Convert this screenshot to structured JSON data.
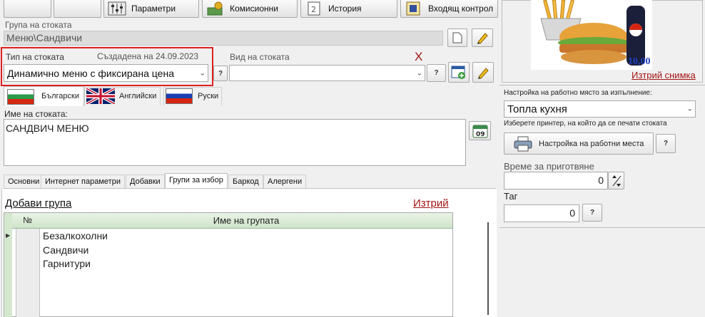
{
  "toolbar": {
    "params_label": "Параметри",
    "commission_label": "Комисионни",
    "history_label": "История",
    "incoming_label": "Входящ контрол"
  },
  "group": {
    "label": "Група на стоката",
    "value": "Меню\\Сандвичи"
  },
  "item_type": {
    "label": "Тип на стоката",
    "created": "Създадена на 24.09.2023",
    "value": "Динамично меню с фиксирана цена",
    "help": "?"
  },
  "kind": {
    "label": "Вид на стоката",
    "clear": "X",
    "value": "",
    "help": "?"
  },
  "languages": {
    "bulgarian": "Български",
    "english": "Английски",
    "russian": "Руски"
  },
  "name": {
    "label": "Име на стоката:",
    "value": "САНДВИЧ МЕНЮ",
    "calendar_day": "09"
  },
  "tabs": [
    "Основни",
    "Интернет параметри",
    "Добавки",
    "Групи за избор",
    "Баркод",
    "Алергени"
  ],
  "groups_panel": {
    "add_link": "Добави група",
    "delete_link": "Изтрий",
    "col_num": "№",
    "col_name": "Име на групата",
    "rows": [
      "Безалкохолни",
      "Сандвичи",
      "Гарнитури"
    ]
  },
  "image_panel": {
    "price": "10,00",
    "delete_link": "Изтрий снимка"
  },
  "workplace": {
    "label": "Настройка на работно място за изпълнение:",
    "value": "Топла кухня",
    "printer_hint": "Изберете принтер, на който да се печати стоката",
    "settings_button": "Настройка на работни места",
    "help": "?"
  },
  "prep_time": {
    "label": "Време за приготвяне",
    "value": "0"
  },
  "tag": {
    "label": "Таг",
    "value": "0",
    "help": "?"
  },
  "colors": {
    "link_red": "#a31515",
    "price_blue": "#1f3fbf",
    "highlight_red": "#e02020",
    "grid_header": "#d9ead3"
  }
}
